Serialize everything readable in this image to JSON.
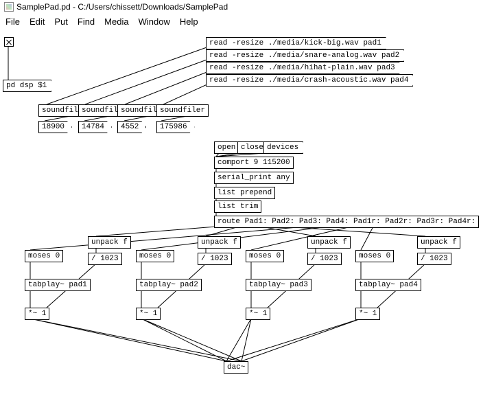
{
  "window": {
    "title": "SamplePad.pd  - C:/Users/chissett/Downloads/SamplePad"
  },
  "menu": [
    "File",
    "Edit",
    "Put",
    "Find",
    "Media",
    "Window",
    "Help"
  ],
  "dsp_msg": "pd dsp $1",
  "read_msgs": [
    "read -resize ./media/kick-big.wav pad1",
    "read -resize ./media/snare-analog.wav pad2",
    "read -resize ./media/hihat-plain.wav pad3",
    "read -resize ./media/crash-acoustic.wav pad4"
  ],
  "soundfiler_label": "soundfiler",
  "sample_counts": [
    "18900",
    "14784",
    "4552",
    "175986"
  ],
  "serial_cmds": {
    "open": "open",
    "close": "close",
    "devices": "devices"
  },
  "comport": "comport 9 115200",
  "serial_print": "serial_print any",
  "list_prepend": "list prepend",
  "list_trim": "list trim",
  "route": "route Pad1: Pad2: Pad3: Pad4: Pad1r: Pad2r: Pad3r: Pad4r:",
  "unpack": "unpack f",
  "moses": "moses 0",
  "div": "/ 1023",
  "tabplay": [
    "tabplay~ pad1",
    "tabplay~ pad2",
    "tabplay~ pad3",
    "tabplay~ pad4"
  ],
  "mult": "*~ 1",
  "dac": "dac~"
}
